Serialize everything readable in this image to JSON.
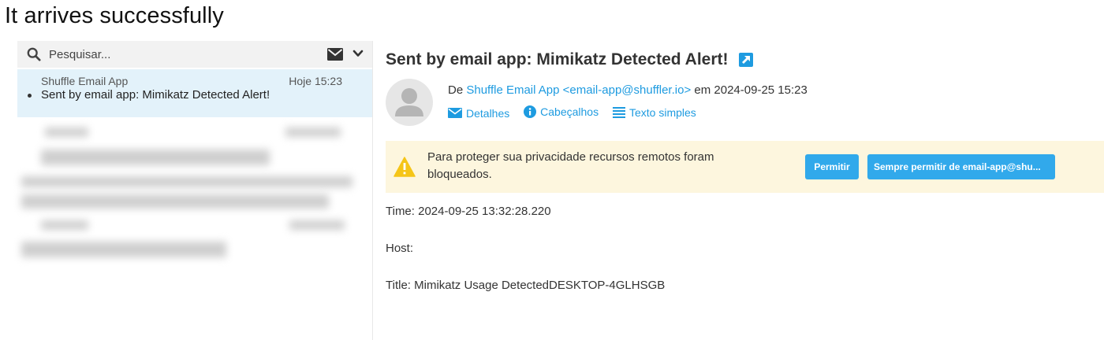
{
  "caption": "It arrives successfully",
  "search": {
    "placeholder": "Pesquisar...",
    "icons": {
      "search": "search-icon",
      "mail": "envelope-icon",
      "menu": "chevron-down-icon"
    }
  },
  "message_list": {
    "selected": {
      "sender": "Shuffle Email App",
      "time": "Hoje 15:23",
      "subject": "Sent by email app: Mimikatz Detected Alert!"
    }
  },
  "message": {
    "subject": "Sent by email app: Mimikatz Detected Alert!",
    "from_prefix": "De",
    "from_name": "Shuffle Email App <email-app@shuffler.io>",
    "from_suffix": "em 2024-09-25 15:23",
    "actions": [
      "Detalhes",
      "Cabeçalhos",
      "Texto simples"
    ],
    "warning": {
      "text": "Para proteger sua privacidade recursos remotos foram bloqueados.",
      "permit_label": "Permitir",
      "always_label": "Sempre permitir de email-app@shu..."
    },
    "body": [
      "Time: 2024-09-25 13:32:28.220",
      "Host:",
      "Title: Mimikatz Usage DetectedDESKTOP-4GLHSGB"
    ]
  },
  "colors": {
    "accent": "#31a9eb",
    "link": "#1e9be0",
    "selected_bg": "#e3f2fa",
    "warning_bg": "#fdf6de"
  }
}
